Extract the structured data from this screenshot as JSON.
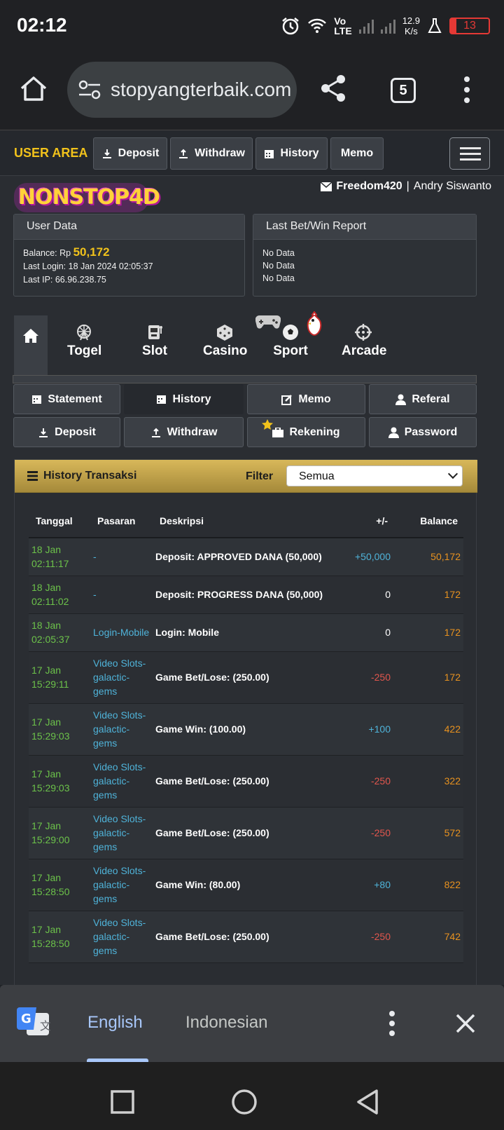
{
  "status_bar": {
    "time": "02:12",
    "network": [
      "Vo",
      "LTE"
    ],
    "speed_value": "12.9",
    "speed_unit": "K/s",
    "battery": "13"
  },
  "browser": {
    "url": "stopyangterbaik.com",
    "tab_count": "5"
  },
  "site": {
    "user_area_label": "USER AREA",
    "top_buttons": [
      "Deposit",
      "Withdraw",
      "History",
      "Memo"
    ],
    "logo_text": "NONSTOP4D",
    "username": "Freedom420",
    "separator": "|",
    "real_name": "Andry Siswanto",
    "user_data": {
      "title": "User Data",
      "balance_label": "Balance: Rp",
      "balance_value": "50,172",
      "last_login": "Last Login: 18 Jan 2024 02:05:37",
      "last_ip": "Last IP: 66.96.238.75"
    },
    "report": {
      "title": "Last Bet/Win Report",
      "lines": [
        "No Data",
        "No Data",
        "No Data"
      ]
    },
    "game_nav": [
      "Togel",
      "Slot",
      "Casino",
      "Sport",
      "Arcade"
    ],
    "menu_grid": [
      "Statement",
      "History",
      "Memo",
      "Referal",
      "Deposit",
      "Withdraw",
      "Rekening",
      "Password"
    ],
    "history": {
      "title": "History Transaksi",
      "filter_label": "Filter",
      "filter_value": "Semua",
      "columns": [
        "Tanggal",
        "Pasaran",
        "Deskripsi",
        "+/-",
        "Balance"
      ],
      "rows": [
        {
          "date": "18 Jan",
          "time": "02:11:17",
          "market": "-",
          "desc": "Deposit: APPROVED DANA (50,000)",
          "change": "+50,000",
          "balance": "50,172"
        },
        {
          "date": "18 Jan",
          "time": "02:11:02",
          "market": "-",
          "desc": "Deposit: PROGRESS DANA (50,000)",
          "change": "0",
          "balance": "172"
        },
        {
          "date": "18 Jan",
          "time": "02:05:37",
          "market": "Login-Mobile",
          "desc": "Login: Mobile",
          "change": "0",
          "balance": "172"
        },
        {
          "date": "17 Jan",
          "time": "15:29:11",
          "market": "Video Slots-galactic-gems",
          "desc": "Game Bet/Lose: (250.00)",
          "change": "-250",
          "balance": "172"
        },
        {
          "date": "17 Jan",
          "time": "15:29:03",
          "market": "Video Slots-galactic-gems",
          "desc": "Game Win: (100.00)",
          "change": "+100",
          "balance": "422"
        },
        {
          "date": "17 Jan",
          "time": "15:29:03",
          "market": "Video Slots-galactic-gems",
          "desc": "Game Bet/Lose: (250.00)",
          "change": "-250",
          "balance": "322"
        },
        {
          "date": "17 Jan",
          "time": "15:29:00",
          "market": "Video Slots-galactic-gems",
          "desc": "Game Bet/Lose: (250.00)",
          "change": "-250",
          "balance": "572"
        },
        {
          "date": "17 Jan",
          "time": "15:28:50",
          "market": "Video Slots-galactic-gems",
          "desc": "Game Win: (80.00)",
          "change": "+80",
          "balance": "822"
        },
        {
          "date": "17 Jan",
          "time": "15:28:50",
          "market": "Video Slots-galactic-gems",
          "desc": "Game Bet/Lose: (250.00)",
          "change": "-250",
          "balance": "742"
        }
      ]
    }
  },
  "translate_bar": {
    "lang_active": "English",
    "lang_other": "Indonesian"
  },
  "colors": {
    "accent_gold": "#f1c21b",
    "positive": "#4fb3d9",
    "negative": "#e0564d",
    "date_green": "#6cc24a",
    "balance_orange": "#e8921f"
  }
}
